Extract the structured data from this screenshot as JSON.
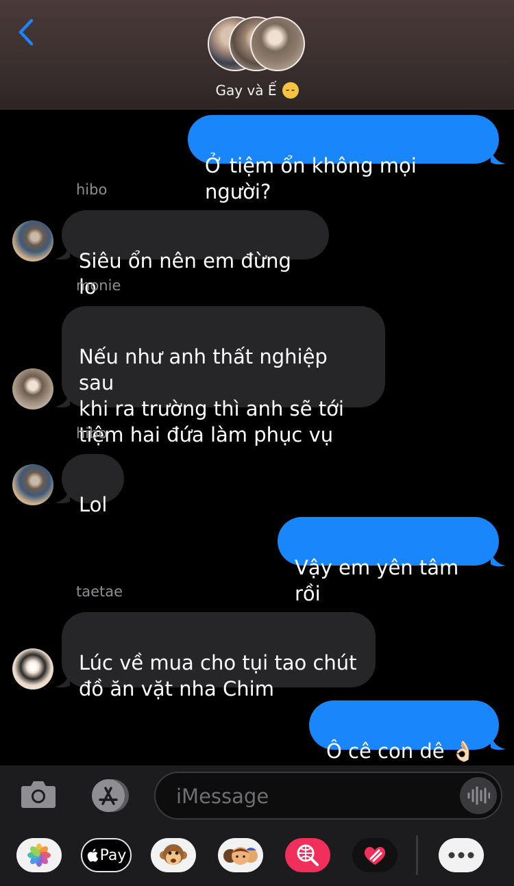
{
  "header": {
    "group_name": "Gay và Ế",
    "title_emoji": "drooling-face-emoji"
  },
  "messages": [
    {
      "direction": "outgoing",
      "text": "Ở tiệm ổn không mọi người?"
    },
    {
      "direction": "incoming",
      "sender": "hibo",
      "text": "Siêu ổn nên em đừng lo"
    },
    {
      "direction": "incoming",
      "sender": "monie",
      "text": "Nếu như anh thất nghiệp sau\nkhi ra trường thì anh sẽ tới\ntiệm hai đứa làm phục vụ"
    },
    {
      "direction": "incoming",
      "sender": "hibo",
      "text": "Lol"
    },
    {
      "direction": "outgoing",
      "text": "Vậy em yên tâm rồi"
    },
    {
      "direction": "incoming",
      "sender": "taetae",
      "text": "Lúc về mua cho tụi tao chút\nđồ ăn vặt nha Chim"
    },
    {
      "direction": "outgoing",
      "text": "Ô cê con dê 👌🏻"
    }
  ],
  "input": {
    "placeholder": "iMessage"
  },
  "app_drawer": {
    "apple_pay_label": "Pay",
    "items": [
      "photos-app",
      "apple-pay-app",
      "animoji-app",
      "memoji-stickers-app",
      "search-images-app",
      "digital-touch-app",
      "more-apps"
    ]
  },
  "colors": {
    "outgoing_bubble": "#1a86fb",
    "incoming_bubble": "#262628",
    "accent": "#1a86fb"
  }
}
